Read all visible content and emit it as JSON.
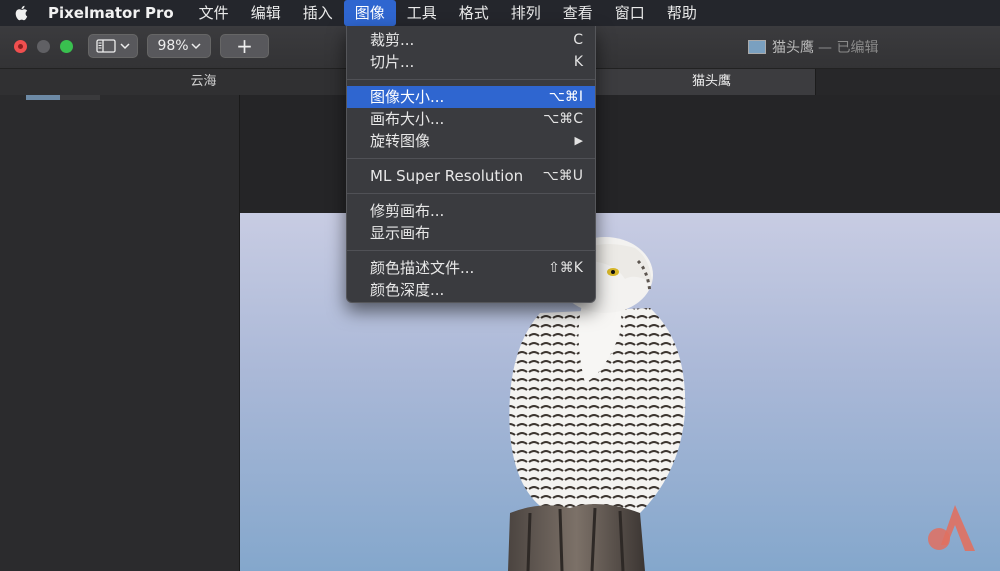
{
  "menubar": {
    "app_name": "Pixelmator Pro",
    "items": [
      "文件",
      "编辑",
      "插入",
      "图像",
      "工具",
      "格式",
      "排列",
      "查看",
      "窗口",
      "帮助"
    ],
    "active_index": 3
  },
  "toolbar": {
    "zoom": "98%",
    "add_label": "+",
    "doc_title": "猫头鹰",
    "doc_status": "— 已编辑"
  },
  "tabs": [
    "云海",
    "猫头鹰"
  ],
  "image_menu": {
    "group1": [
      {
        "label": "裁剪...",
        "shortcut": "C"
      },
      {
        "label": "切片...",
        "shortcut": "K"
      }
    ],
    "group2": [
      {
        "label": "图像大小...",
        "shortcut": "⌥⌘I"
      },
      {
        "label": "画布大小...",
        "shortcut": "⌥⌘C"
      },
      {
        "label": "旋转图像",
        "shortcut": "▶"
      }
    ],
    "group3": [
      {
        "label": "ML Super Resolution",
        "shortcut": "⌥⌘U"
      }
    ],
    "group4": [
      {
        "label": "修剪画布...",
        "shortcut": ""
      },
      {
        "label": "显示画布",
        "shortcut": ""
      }
    ],
    "group5": [
      {
        "label": "颜色描述文件...",
        "shortcut": "⇧⌘K"
      },
      {
        "label": "颜色深度...",
        "shortcut": ""
      }
    ]
  },
  "colors": {
    "highlight": "#2f66d0",
    "close": "#f04f4f",
    "maximize": "#39c04f",
    "watermark": "#e07060"
  },
  "icons": [
    "apple-icon",
    "sidebar-toggle-icon",
    "chevron-down-icon",
    "plus-icon",
    "document-thumbnail-icon",
    "submenu-arrow-icon"
  ]
}
